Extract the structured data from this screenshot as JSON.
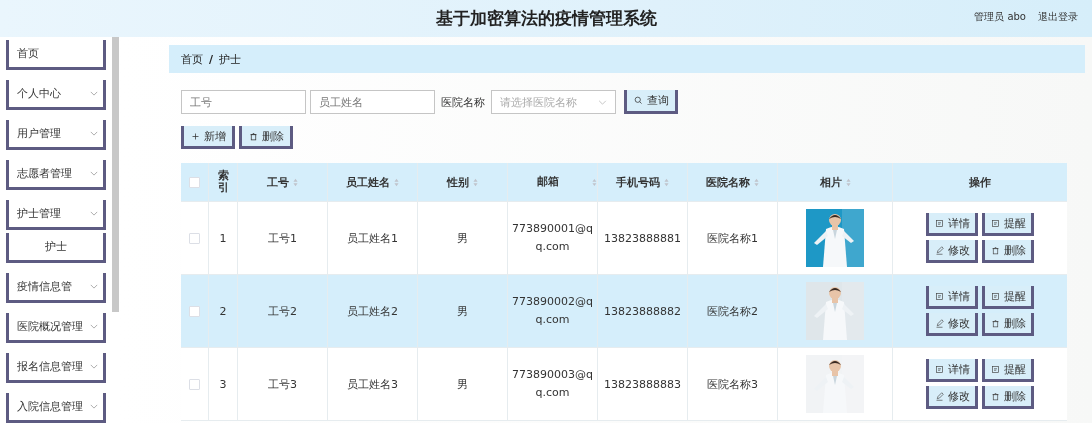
{
  "header": {
    "title": "基于加密算法的疫情管理系统",
    "user": "管理员 abo",
    "logout": "退出登录"
  },
  "sidebar": {
    "items": [
      {
        "label": "首页",
        "kind": "link"
      },
      {
        "label": "个人中心",
        "kind": "menu"
      },
      {
        "label": "用户管理",
        "kind": "menu"
      },
      {
        "label": "志愿者管理",
        "kind": "menu"
      },
      {
        "label": "护士管理",
        "kind": "menu",
        "children": [
          {
            "label": "护士",
            "kind": "sub"
          }
        ]
      },
      {
        "label": "疫情信息管",
        "kind": "menu"
      },
      {
        "label": "医院概况管理",
        "kind": "menu"
      },
      {
        "label": "报名信息管理",
        "kind": "menu"
      },
      {
        "label": "入院信息管理",
        "kind": "menu"
      }
    ]
  },
  "breadcrumb": {
    "items": [
      "首页",
      "护士"
    ],
    "separator": "/"
  },
  "search": {
    "fields": [
      {
        "placeholder": "工号"
      },
      {
        "placeholder": "员工姓名"
      }
    ],
    "select_label": "医院名称",
    "select_placeholder": "请选择医院名称",
    "query_button": "查询"
  },
  "actions": [
    "新增",
    "删除"
  ],
  "table": {
    "select_all_checked": false,
    "columns": [
      {
        "label": "索引",
        "sortable": false
      },
      {
        "label": "工号",
        "sortable": true
      },
      {
        "label": "员工姓名",
        "sortable": true
      },
      {
        "label": "性别",
        "sortable": true
      },
      {
        "label": "邮箱",
        "sortable": true
      },
      {
        "label": "手机号码",
        "sortable": true
      },
      {
        "label": "医院名称",
        "sortable": true
      },
      {
        "label": "相片",
        "sortable": true
      },
      {
        "label": "操作",
        "sortable": false
      }
    ],
    "rows": [
      {
        "checked": false,
        "cells": [
          "1",
          "工号1",
          "员工姓名1",
          "男",
          "773890001@qq.com",
          "13823888881",
          "医院名称1"
        ],
        "ops": [
          {
            "kind": "view",
            "label": "详情"
          },
          {
            "kind": "remind",
            "label": "提醒"
          },
          {
            "kind": "edit",
            "label": "修改"
          },
          {
            "kind": "delete",
            "label": "删除"
          }
        ]
      },
      {
        "checked": false,
        "cells": [
          "2",
          "工号2",
          "员工姓名2",
          "男",
          "773890002@qq.com",
          "13823888882",
          "医院名称2"
        ],
        "ops": [
          {
            "kind": "view",
            "label": "详情"
          },
          {
            "kind": "remind",
            "label": "提醒"
          },
          {
            "kind": "edit",
            "label": "修改"
          },
          {
            "kind": "delete",
            "label": "删除"
          }
        ]
      },
      {
        "checked": false,
        "cells": [
          "3",
          "工号3",
          "员工姓名3",
          "男",
          "773890003@qq.com",
          "13823888883",
          "医院名称3"
        ],
        "ops": [
          {
            "kind": "view",
            "label": "详情"
          },
          {
            "kind": "remind",
            "label": "提醒"
          },
          {
            "kind": "edit",
            "label": "修改"
          },
          {
            "kind": "delete",
            "label": "删除"
          }
        ]
      }
    ]
  }
}
